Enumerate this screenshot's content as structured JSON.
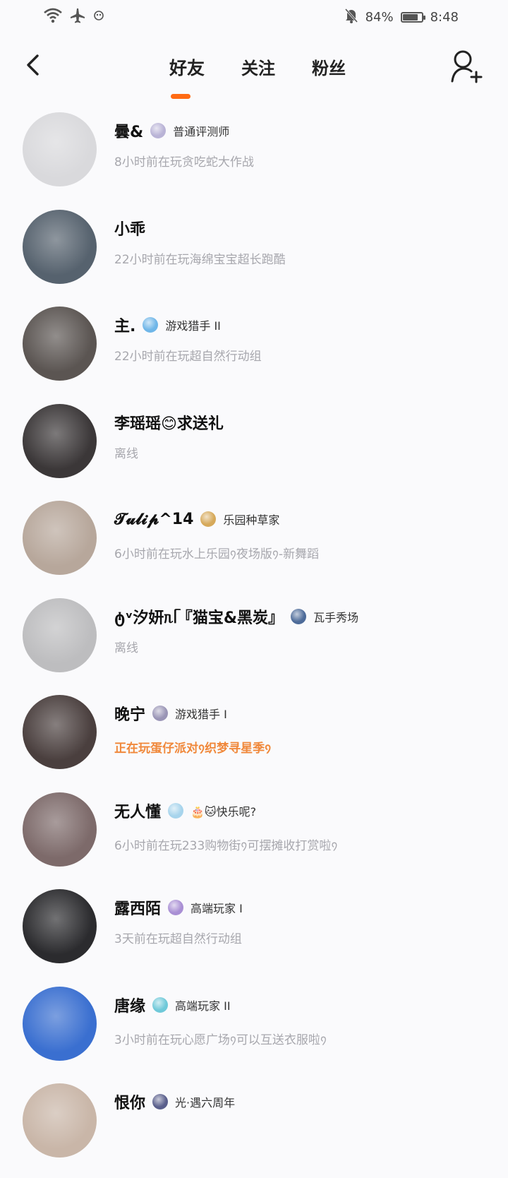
{
  "status_bar": {
    "battery": "84%",
    "time": "8:48",
    "battery_level": 0.84,
    "icons": [
      "wifi-icon",
      "airplane-icon",
      "notification-app-icon",
      "bell-muted-icon",
      "battery-icon"
    ]
  },
  "nav": {
    "back_icon": "chevron-left-icon",
    "add_icon": "add-friend-icon",
    "tabs": [
      {
        "label": "好友"
      },
      {
        "label": "关注"
      },
      {
        "label": "粉丝"
      }
    ],
    "accent": "#ff6a13"
  },
  "friends": [
    {
      "name": "曇&",
      "badge": "普通评测师",
      "status": "8小时前在玩贪吃蛇大作战",
      "avatar_color": "#d9d9dc",
      "badge_color": "#b9b3d6"
    },
    {
      "name": "小乖",
      "badge": "",
      "status": "22小时前在玩海绵宝宝超长跑酷",
      "avatar_color": "#56626e",
      "badge_color": ""
    },
    {
      "name": "主.",
      "badge": "游戏猎手 II",
      "status": "22小时前在玩超自然行动组",
      "avatar_color": "#5b5552",
      "badge_color": "#6fb6e8"
    },
    {
      "name": "李瑶瑶😊求送礼",
      "badge": "",
      "status": "离线",
      "avatar_color": "#3b3738",
      "badge_color": ""
    },
    {
      "name": "𝓣𝓾𝓵𝓲𝓹^14",
      "badge": "乐园种草家",
      "status": "6小时前在玩水上乐园᠀夜场版᠀-新舞蹈",
      "avatar_color": "#b7a79b",
      "badge_color": "#d6a95a"
    },
    {
      "name": "ტᵛ汐妍ᥰᥬ『猫宝&黑炭』",
      "badge": "瓦手秀场",
      "status": "离线",
      "avatar_color": "#bdbdbf",
      "badge_color": "#4d6b99"
    },
    {
      "name": "晚宁",
      "badge": "游戏猎手 I",
      "status": "正在玩蛋仔派对᠀织梦寻星季᠀",
      "online": true,
      "avatar_color": "#4a3f3e",
      "badge_color": "#9a95b6"
    },
    {
      "name": "无人懂",
      "badge": "🎂🐱快乐呢?",
      "status": "6小时前在玩233购物街᠀可摆摊收打赏啦᠀",
      "avatar_color": "#7d6a6a",
      "badge_color": "#a7d4ec"
    },
    {
      "name": "露西陌",
      "badge": "高端玩家 I",
      "status": "3天前在玩超自然行动组",
      "avatar_color": "#2b2b2e",
      "badge_color": "#a98fd4"
    },
    {
      "name": "唐缘",
      "badge": "高端玩家 II",
      "status": "3小时前在玩心愿广场᠀可以互送衣服啦᠀",
      "avatar_color": "#3a6fd0",
      "badge_color": "#6fc9d9"
    },
    {
      "name": "恨你",
      "badge": "光·遇六周年",
      "status": "",
      "avatar_color": "#c9b6a8",
      "badge_color": "#5a5f8c"
    }
  ]
}
